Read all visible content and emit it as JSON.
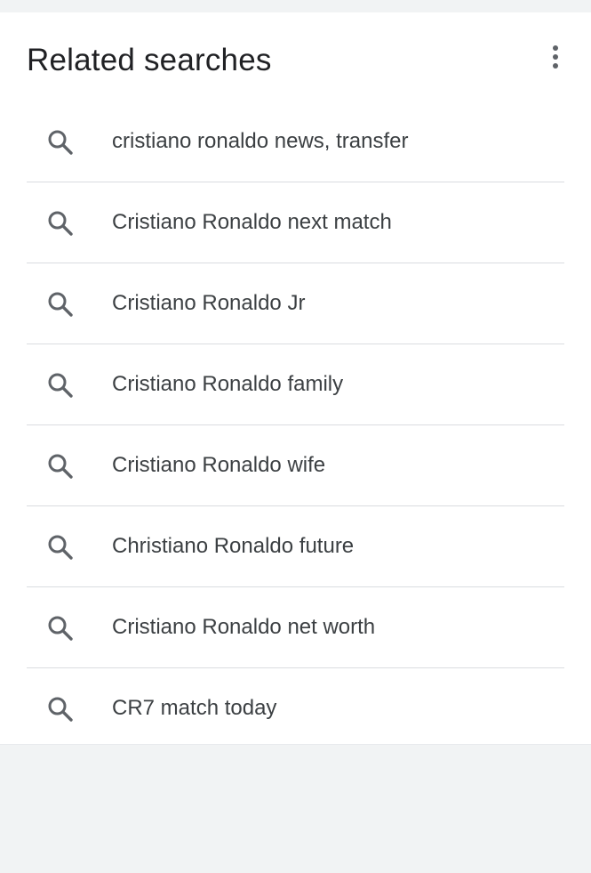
{
  "related": {
    "title": "Related searches",
    "more_icon": "more-vert-icon",
    "items": [
      {
        "label": "cristiano ronaldo news, transfer",
        "icon": "search-icon"
      },
      {
        "label": "Cristiano Ronaldo next match",
        "icon": "search-icon"
      },
      {
        "label": "Cristiano Ronaldo Jr",
        "icon": "search-icon"
      },
      {
        "label": "Cristiano Ronaldo family",
        "icon": "search-icon"
      },
      {
        "label": "Cristiano Ronaldo wife",
        "icon": "search-icon"
      },
      {
        "label": "Christiano Ronaldo future",
        "icon": "search-icon"
      },
      {
        "label": "Cristiano Ronaldo net worth",
        "icon": "search-icon"
      },
      {
        "label": "CR7 match today",
        "icon": "search-icon"
      }
    ]
  },
  "colors": {
    "page_background": "#f1f3f4",
    "card_background": "#ffffff",
    "title_text": "#202124",
    "item_text": "#3c4043",
    "icon": "#5f6368",
    "divider": "#dadce0"
  }
}
